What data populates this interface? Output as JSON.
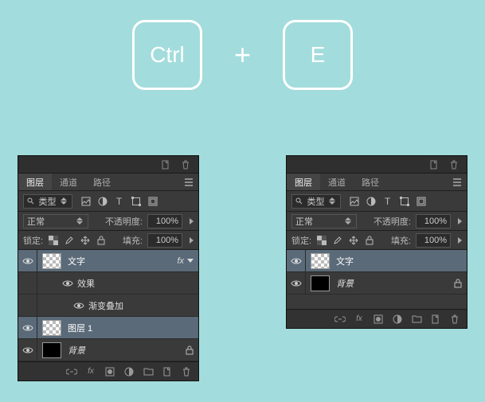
{
  "shortcut": {
    "key1": "Ctrl",
    "plus": "+",
    "key2": "E"
  },
  "panel_left": {
    "tabs": {
      "layers": "图层",
      "channels": "通道",
      "paths": "路径"
    },
    "kind_filter": "类型",
    "blend_mode": "正常",
    "opacity_label": "不透明度:",
    "opacity_value": "100%",
    "lock_label": "锁定:",
    "fill_label": "填充:",
    "fill_value": "100%",
    "layers": [
      {
        "name": "文字",
        "fx": "fx"
      },
      {
        "name": "效果"
      },
      {
        "name": "渐变叠加"
      },
      {
        "name": "图层 1"
      },
      {
        "name": "背景"
      }
    ]
  },
  "panel_right": {
    "tabs": {
      "layers": "图层",
      "channels": "通道",
      "paths": "路径"
    },
    "kind_filter": "类型",
    "blend_mode": "正常",
    "opacity_label": "不透明度:",
    "opacity_value": "100%",
    "lock_label": "锁定:",
    "fill_label": "填充:",
    "fill_value": "100%",
    "layers": [
      {
        "name": "文字"
      },
      {
        "name": "背景"
      }
    ]
  },
  "icons": {
    "search": "search-icon",
    "image": "image-filter-icon",
    "adjust": "adjust-filter-icon",
    "type": "type-filter-icon",
    "shape": "shape-filter-icon",
    "smart": "smart-filter-icon"
  }
}
